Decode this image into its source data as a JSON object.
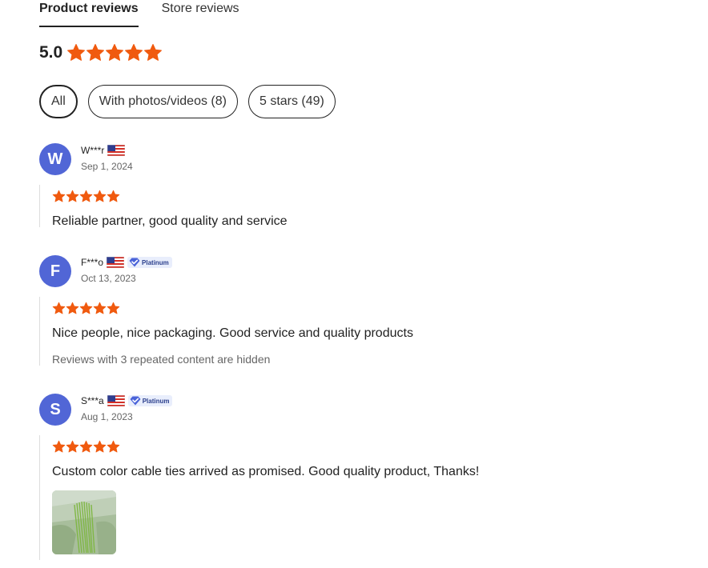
{
  "tabs": [
    {
      "label": "Product reviews",
      "active": true
    },
    {
      "label": "Store reviews",
      "active": false
    }
  ],
  "rating": {
    "value": "5.0",
    "stars": 5
  },
  "filters": [
    {
      "label": "All",
      "active": true
    },
    {
      "label": "With photos/videos (8)",
      "active": false
    },
    {
      "label": "5 stars (49)",
      "active": false
    }
  ],
  "colors": {
    "star": "#f05a0f",
    "avatar": "#5166d6",
    "badge_bg": "#e9eefc"
  },
  "reviews": [
    {
      "initial": "W",
      "name": "W***r",
      "country_flag": "us-flag",
      "badge": "",
      "date": "Sep 1, 2024",
      "stars": 5,
      "text": "Reliable partner, good quality and service",
      "note": "",
      "photo": false
    },
    {
      "initial": "F",
      "name": "F***o",
      "country_flag": "us-flag",
      "badge": "Platinum",
      "date": "Oct 13, 2023",
      "stars": 5,
      "text": "Nice people, nice packaging. Good service and quality products",
      "note": "Reviews with 3 repeated content are hidden",
      "photo": false
    },
    {
      "initial": "S",
      "name": "S***a",
      "country_flag": "us-flag",
      "badge": "Platinum",
      "date": "Aug 1, 2023",
      "stars": 5,
      "text": "Custom color cable ties arrived as promised. Good quality product, Thanks!",
      "note": "",
      "photo": true
    }
  ]
}
